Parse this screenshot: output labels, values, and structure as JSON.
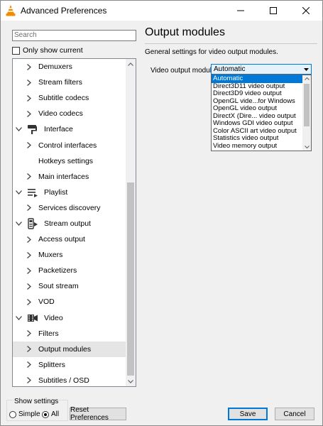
{
  "window": {
    "title": "Advanced Preferences",
    "icons": {
      "app": "vlc-cone-icon",
      "minimize": "minimize-icon",
      "maximize": "maximize-icon",
      "close": "close-icon"
    }
  },
  "sidebar": {
    "search_placeholder": "Search",
    "only_show_current": {
      "label": "Only show current",
      "checked": false
    },
    "tree": [
      {
        "label": "Demuxers",
        "type": "child",
        "expanded": false
      },
      {
        "label": "Stream filters",
        "type": "child",
        "expanded": false
      },
      {
        "label": "Subtitle codecs",
        "type": "child",
        "expanded": false
      },
      {
        "label": "Video codecs",
        "type": "child",
        "expanded": false
      },
      {
        "label": "Interface",
        "type": "category",
        "expanded": true,
        "icon": "paint-roller-icon"
      },
      {
        "label": "Control interfaces",
        "type": "child",
        "expanded": false
      },
      {
        "label": "Hotkeys settings",
        "type": "child",
        "no_chevron": true
      },
      {
        "label": "Main interfaces",
        "type": "child",
        "expanded": false
      },
      {
        "label": "Playlist",
        "type": "category",
        "expanded": true,
        "icon": "playlist-icon"
      },
      {
        "label": "Services discovery",
        "type": "child",
        "expanded": false
      },
      {
        "label": "Stream output",
        "type": "category",
        "expanded": true,
        "icon": "stream-output-icon"
      },
      {
        "label": "Access output",
        "type": "child",
        "expanded": false
      },
      {
        "label": "Muxers",
        "type": "child",
        "expanded": false
      },
      {
        "label": "Packetizers",
        "type": "child",
        "expanded": false
      },
      {
        "label": "Sout stream",
        "type": "child",
        "expanded": false
      },
      {
        "label": "VOD",
        "type": "child",
        "expanded": false
      },
      {
        "label": "Video",
        "type": "category",
        "expanded": true,
        "icon": "video-icon"
      },
      {
        "label": "Filters",
        "type": "child",
        "expanded": false
      },
      {
        "label": "Output modules",
        "type": "child",
        "expanded": false,
        "selected": true
      },
      {
        "label": "Splitters",
        "type": "child",
        "expanded": false
      },
      {
        "label": "Subtitles / OSD",
        "type": "child",
        "expanded": false
      }
    ],
    "scroll_position": 0.62
  },
  "panel": {
    "title": "Output modules",
    "description": "General settings for video output modules.",
    "video_output_module": {
      "label": "Video output module",
      "value": "Automatic",
      "options": [
        "Automatic",
        "Direct3D11 video output",
        "Direct3D9 video output",
        "OpenGL vide...for Windows",
        "OpenGL video output",
        "DirectX (Dire... video output",
        "Windows GDI video output",
        "Color ASCII art video output",
        "Statistics video output",
        "Video memory output"
      ],
      "selected_index": 0
    }
  },
  "footer": {
    "show_settings_label": "Show settings",
    "simple_label": "Simple",
    "all_label": "All",
    "selected": "All",
    "reset_label": "Reset Preferences",
    "save_label": "Save",
    "cancel_label": "Cancel"
  },
  "colors": {
    "accent": "#0078d7",
    "selected_row": "#e5e5e5",
    "vlc_orange": "#f08c00"
  }
}
